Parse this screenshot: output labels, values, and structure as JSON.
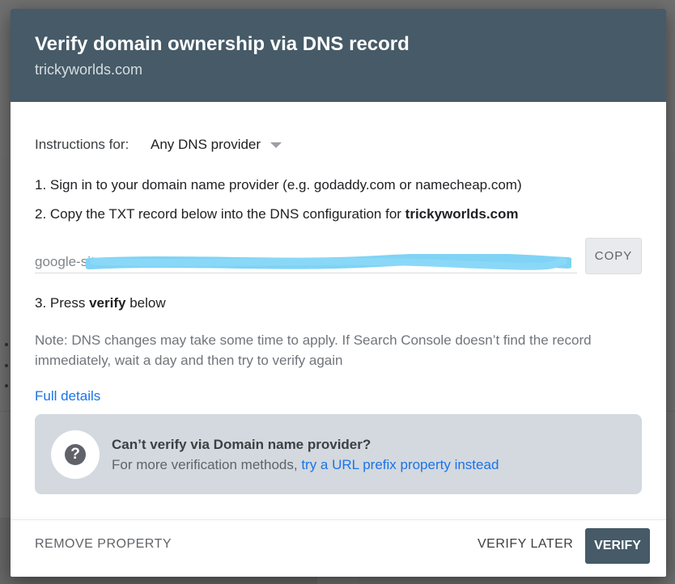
{
  "dialog": {
    "title": "Verify domain ownership via DNS record",
    "subtitle": "trickyworlds.com"
  },
  "instructions": {
    "label": "Instructions for:",
    "provider": "Any DNS provider"
  },
  "steps": {
    "step1": "1. Sign in to your domain name provider (e.g. godaddy.com or namecheap.com)",
    "step2_prefix": "2. Copy the TXT record below into the DNS configuration for ",
    "step2_domain": "trickyworlds.com",
    "step3_prefix": "3. Press ",
    "step3_bold": "verify",
    "step3_suffix": " below"
  },
  "txt_record": {
    "visible_prefix": "google-site-",
    "redacted": true
  },
  "copy_button": "COPY",
  "note": "Note: DNS changes may take some time to apply. If Search Console doesn’t find the record immediately, wait a day and then try to verify again",
  "full_details": "Full details",
  "help": {
    "title": "Can’t verify via Domain name provider?",
    "text": "For more verification methods, ",
    "link": "try a URL prefix property instead",
    "icon": "help-question-icon"
  },
  "footer": {
    "remove": "REMOVE PROPERTY",
    "verify_later": "VERIFY LATER",
    "verify": "VERIFY"
  },
  "colors": {
    "header_bg": "#465a67",
    "link": "#1a73e8",
    "help_bg": "#d3d9df",
    "redaction": "#7fd3f5"
  }
}
